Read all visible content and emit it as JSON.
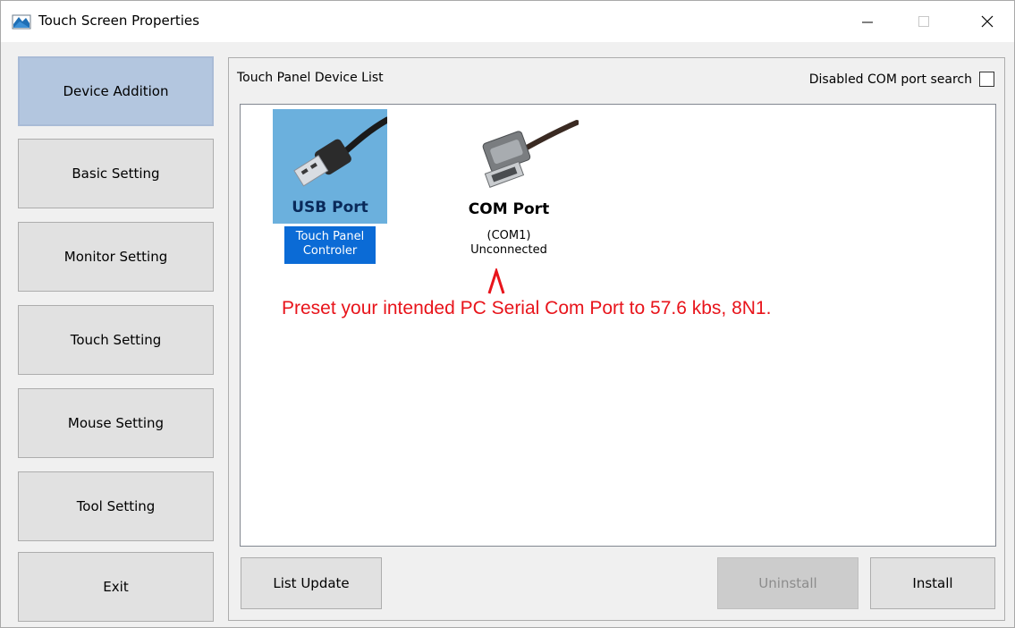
{
  "window": {
    "title": "Touch Screen Properties"
  },
  "sidebar": {
    "items": [
      {
        "label": "Device Addition",
        "active": true
      },
      {
        "label": "Basic Setting"
      },
      {
        "label": "Monitor Setting"
      },
      {
        "label": "Touch Setting"
      },
      {
        "label": "Mouse Setting"
      },
      {
        "label": "Tool Setting"
      },
      {
        "label": "Exit"
      }
    ]
  },
  "panel": {
    "title": "Touch Panel Device List",
    "disabled_com_search_label": "Disabled COM port search",
    "disabled_com_search_checked": false
  },
  "devices": {
    "usb": {
      "name": "USB Port",
      "caption_line1": "Touch Panel",
      "caption_line2": "Controler",
      "selected": true
    },
    "com": {
      "name": "COM Port",
      "caption_line1": "(COM1)",
      "caption_line2": "Unconnected"
    }
  },
  "annotation": {
    "arrow": "Λ",
    "text": "Preset your intended PC Serial Com Port to 57.6 kbs, 8N1."
  },
  "buttons": {
    "list_update": "List Update",
    "uninstall": "Uninstall",
    "install": "Install"
  },
  "colors": {
    "selected_tile": "#6bb0dd",
    "selected_caption": "#0b6bd6",
    "active_nav": "#b3c6df",
    "annotation": "#e8141b"
  }
}
